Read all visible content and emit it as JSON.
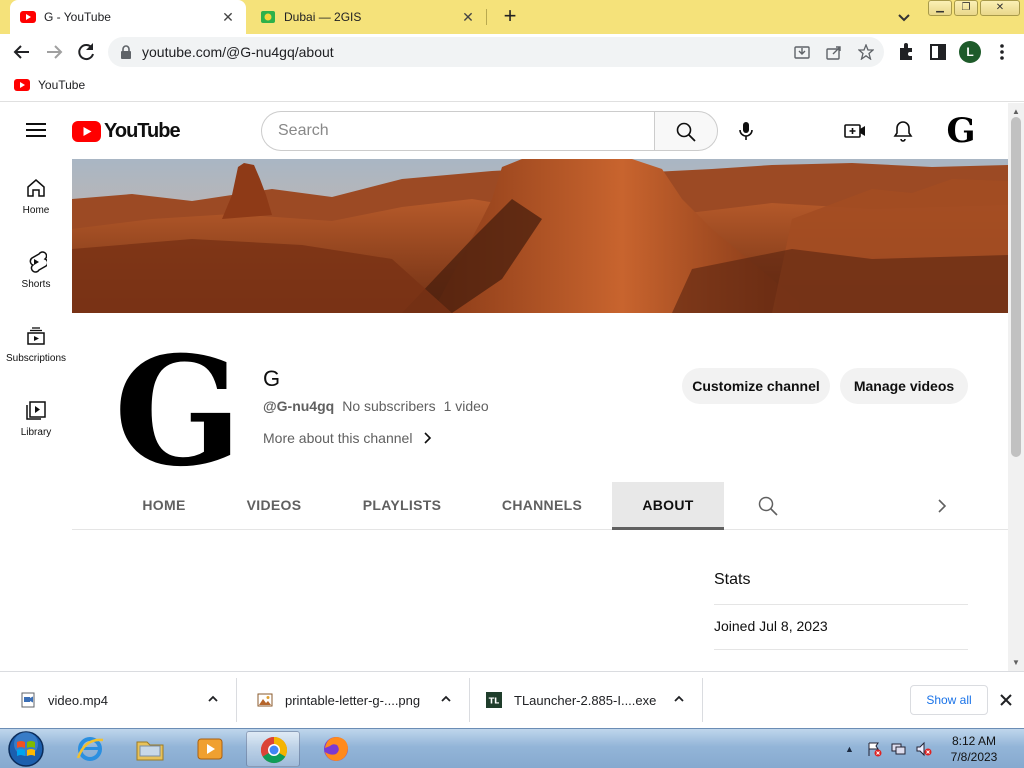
{
  "browser": {
    "tabs": [
      {
        "title": "G - YouTube",
        "active": true
      },
      {
        "title": "Dubai — 2GIS",
        "active": false
      }
    ],
    "url": "youtube.com/@G-nu4gq/about",
    "profile_initial": "L",
    "bookmarks": [
      {
        "label": "YouTube"
      }
    ]
  },
  "youtube": {
    "search_placeholder": "Search",
    "header_avatar": "G",
    "guide": [
      {
        "label": "Home",
        "icon": "home-icon"
      },
      {
        "label": "Shorts",
        "icon": "shorts-icon"
      },
      {
        "label": "Subscriptions",
        "icon": "subscriptions-icon"
      },
      {
        "label": "Library",
        "icon": "library-icon"
      }
    ],
    "channel": {
      "avatar_letter": "G",
      "name": "G",
      "handle": "@G-nu4gq",
      "subscribers": "No subscribers",
      "videos": "1 video",
      "more": "More about this channel",
      "customize_label": "Customize channel",
      "manage_label": "Manage videos"
    },
    "tabs": [
      "HOME",
      "VIDEOS",
      "PLAYLISTS",
      "CHANNELS",
      "ABOUT"
    ],
    "active_tab": "ABOUT",
    "stats": {
      "heading": "Stats",
      "joined": "Joined Jul 8, 2023"
    }
  },
  "downloads": {
    "items": [
      {
        "name": "video.mp4"
      },
      {
        "name": "printable-letter-g-....png"
      },
      {
        "name": "TLauncher-2.885-I....exe"
      }
    ],
    "show_all": "Show all"
  },
  "taskbar": {
    "time": "8:12 AM",
    "date": "7/8/2023"
  }
}
